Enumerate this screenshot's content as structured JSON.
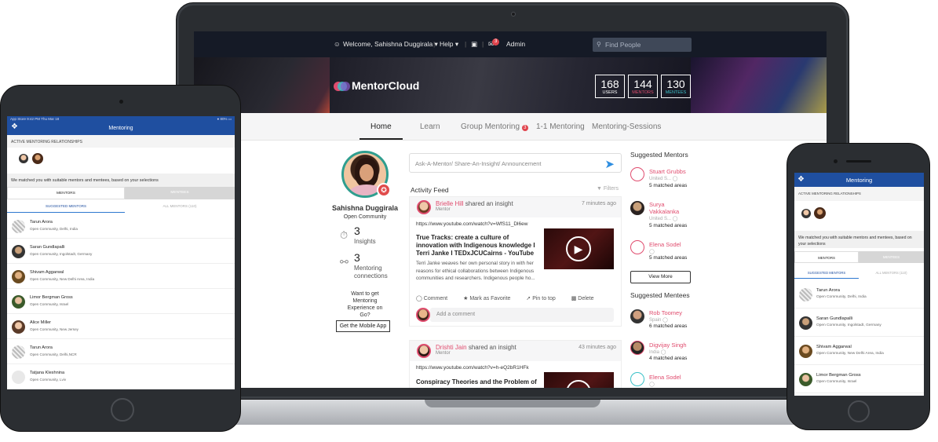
{
  "laptop": {
    "topbar": {
      "welcome": "Welcome, Sahishna Duggirala",
      "help": "Help",
      "notifications": "3",
      "admin": "Admin",
      "search_placeholder": "Find People"
    },
    "banner": {
      "logo": "MentorCloud",
      "stats": [
        {
          "value": "168",
          "label": "USERS"
        },
        {
          "value": "144",
          "label": "MENTORS"
        },
        {
          "value": "130",
          "label": "MENTEES"
        }
      ],
      "colors": {
        "mentors": "#e04c6e",
        "mentees": "#3ac1c8"
      }
    },
    "nav": {
      "tabs": [
        "Home",
        "Learn",
        "Group Mentoring",
        "1-1 Mentoring",
        "Mentoring-Sessions"
      ],
      "group_badge": "3",
      "active": "Home"
    },
    "profile": {
      "name": "Sahishna Duggirala",
      "community": "Open Community",
      "insights_count": "3",
      "insights_label": "Insights",
      "connections_count": "3",
      "connections_label": "Mentoring connections",
      "promo": "Want to get Mentoring Experience on Go?",
      "app_button": "Get the Mobile App"
    },
    "feed": {
      "ask_placeholder": "Ask-A-Mentor/ Share-An-Insight/ Announcement",
      "title": "Activity Feed",
      "filters": "Filters",
      "posts": [
        {
          "author": "Brielle Hill",
          "action": "shared an insight",
          "role": "Mentor",
          "time": "7 minutes ago",
          "url": "https://www.youtube.com/watch?v=WfS11_Dl6ew",
          "title": "True Tracks: create a culture of innovation with Indigenous knowledge I Terri Janke I TEDxJCUCairns - YouTube",
          "desc": "Terri Janke weaves her own personal story in with her reasons for ethical collaborations between Indigenous communities and researchers. Indigenous people ho...",
          "actions": [
            "Comment",
            "Mark as Favorite",
            "Pin to top",
            "Delete"
          ],
          "comment_placeholder": "Add a comment"
        },
        {
          "author": "Drishti Jain",
          "action": "shared an insight",
          "role": "Mentor",
          "time": "43 minutes ago",
          "url": "https://www.youtube.com/watch?v=h-eQ2bR1HFk",
          "title": "Conspiracy Theories and the Problem of"
        }
      ]
    },
    "suggested_mentors": {
      "title": "Suggested Mentors",
      "items": [
        {
          "name": "Stuart Grubbs",
          "location": "United S...",
          "matched": "5 matched areas"
        },
        {
          "name": "Surya Vakkalanka",
          "location": "United S...",
          "matched": "5 matched areas"
        },
        {
          "name": "Elena Sodel",
          "location": "",
          "matched": "5 matched areas"
        }
      ],
      "view_more": "View More"
    },
    "suggested_mentees": {
      "title": "Suggested Mentees",
      "items": [
        {
          "name": "Rob Toomey",
          "location": "Spain",
          "matched": "6 matched areas"
        },
        {
          "name": "Digvijay Singh",
          "location": "India",
          "matched": "4 matched areas"
        },
        {
          "name": "Elena Sodel",
          "location": "",
          "matched": ""
        }
      ]
    }
  },
  "tablet": {
    "status_left": "App Store  9:42 PM  Thu Mar 18",
    "status_right": "80%",
    "title": "Mentoring",
    "active_label": "ACTIVE MENTORING RELATIONSHIPS",
    "match_message": "We matched you with suitable mentors and mentees, based on your selections",
    "toggle": [
      "MENTORS",
      "MENTEES"
    ],
    "subtabs": [
      "SUGGESTED MENTORS",
      "ALL MENTORS (110)"
    ],
    "people": [
      {
        "name": "Tarun Arora",
        "location": "Open Community, Delhi, India"
      },
      {
        "name": "Saran Gundlapalli",
        "location": "Open Community, Ingolstadt, Germany"
      },
      {
        "name": "Shivam Aggarwal",
        "location": "Open Community, New Delhi Area, India"
      },
      {
        "name": "Limor Bergman Gross",
        "location": "Open Community, Israel"
      },
      {
        "name": "Alice Miller",
        "location": "Open Community, New Jersey"
      },
      {
        "name": "Tarun Arora",
        "location": "Open Community, Delhi,NCR"
      },
      {
        "name": "Tatjana Kleshnina",
        "location": "Open Community, Lviv"
      }
    ]
  },
  "phone": {
    "title": "Mentoring",
    "active_label": "ACTIVE MENTORING RELATIONSHIPS",
    "match_message": "We matched you with suitable mentors and mentees, based on your selections",
    "toggle": [
      "MENTORS",
      "MENTEES"
    ],
    "subtabs": [
      "SUGGESTED MENTORS",
      "ALL MENTORS (110)"
    ],
    "people": [
      {
        "name": "Tarun Arora",
        "location": "Open Community, Delhi, India"
      },
      {
        "name": "Saran Gundlapalli",
        "location": "Open Community, Ingolstadt, Germany"
      },
      {
        "name": "Shivam Aggarwal",
        "location": "Open Community, New Delhi Area, India"
      },
      {
        "name": "Limor Bergman Gross",
        "location": "Open Community, Israel"
      }
    ]
  }
}
